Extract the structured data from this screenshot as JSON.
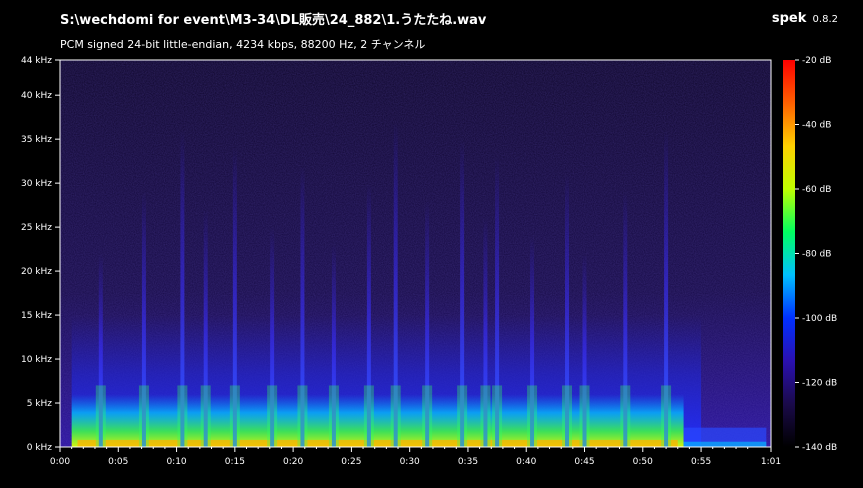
{
  "header": {
    "title": "S:\\wechdomi for event\\M3-34\\DL販売\\24_882\\1.うたたね.wav",
    "subtitle": "PCM signed 24-bit little-endian, 4234 kbps, 88200 Hz, 2 チャンネル"
  },
  "brand": {
    "name": "spek",
    "version": "0.8.2"
  },
  "chart_data": {
    "type": "heatmap",
    "y_axis": {
      "unit": "kHz",
      "ylim": [
        0,
        44
      ],
      "ticks": [
        "0 kHz",
        "5 kHz",
        "10 kHz",
        "15 kHz",
        "20 kHz",
        "25 kHz",
        "30 kHz",
        "35 kHz",
        "40 kHz",
        "44 kHz"
      ],
      "tick_values": [
        0,
        5,
        10,
        15,
        20,
        25,
        30,
        35,
        40,
        44
      ]
    },
    "x_axis": {
      "unit": "seconds",
      "xlim": [
        0,
        61
      ],
      "ticks": [
        "0:00",
        "0:05",
        "0:10",
        "0:15",
        "0:20",
        "0:25",
        "0:30",
        "0:35",
        "0:40",
        "0:45",
        "0:50",
        "0:55",
        "1:01"
      ],
      "tick_values": [
        0,
        5,
        10,
        15,
        20,
        25,
        30,
        35,
        40,
        45,
        50,
        55,
        61
      ]
    },
    "colorbar": {
      "unit": "dB",
      "range": [
        -140,
        -20
      ],
      "ticks": [
        "-20 dB",
        "-40 dB",
        "-60 dB",
        "-80 dB",
        "-100 dB",
        "-120 dB",
        "-140 dB"
      ],
      "tick_values": [
        -20,
        -40,
        -60,
        -80,
        -100,
        -120,
        -140
      ],
      "colors": [
        "#000000",
        "#1a0a4a",
        "#2a10b0",
        "#0030ff",
        "#00c0ff",
        "#00ff60",
        "#c0ff00",
        "#ffd000",
        "#ff6000",
        "#ff0000"
      ]
    },
    "events_seconds": [
      3.5,
      7.2,
      10.5,
      12.5,
      15.0,
      18.2,
      20.8,
      23.5,
      26.5,
      28.8,
      31.5,
      34.5,
      36.5,
      37.5,
      40.5,
      43.5,
      45.0,
      48.5,
      52.0
    ]
  }
}
